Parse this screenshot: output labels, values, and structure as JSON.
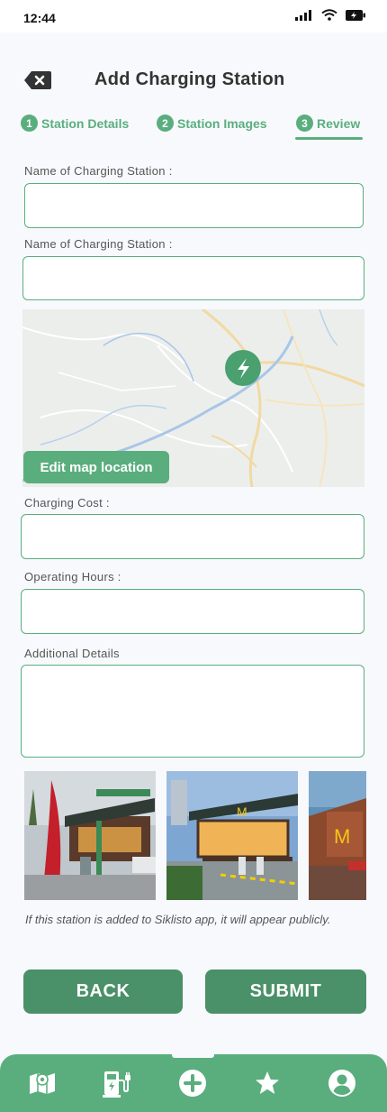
{
  "status_bar": {
    "time": "12:44"
  },
  "header": {
    "title": "Add Charging Station"
  },
  "steps": [
    {
      "number": "1",
      "label": "Station Details"
    },
    {
      "number": "2",
      "label": "Station Images"
    },
    {
      "number": "3",
      "label": "Review"
    }
  ],
  "form": {
    "name_label": "Name of Charging Station :",
    "name_value": "",
    "name2_label": "Name of Charging Station :",
    "name2_value": "",
    "edit_map_label": "Edit map location",
    "cost_label": "Charging Cost :",
    "cost_value": "",
    "hours_label": "Operating Hours :",
    "hours_value": "",
    "details_label": "Additional Details",
    "details_value": ""
  },
  "note": "If this station is added to Siklisto app, it will appear publicly.",
  "buttons": {
    "back": "BACK",
    "submit": "SUBMIT"
  },
  "colors": {
    "accent": "#5aae7e",
    "button": "#4a9068"
  },
  "nav_icons": [
    "map-icon",
    "ev-charger-icon",
    "add-circle-icon",
    "star-icon",
    "account-icon"
  ]
}
